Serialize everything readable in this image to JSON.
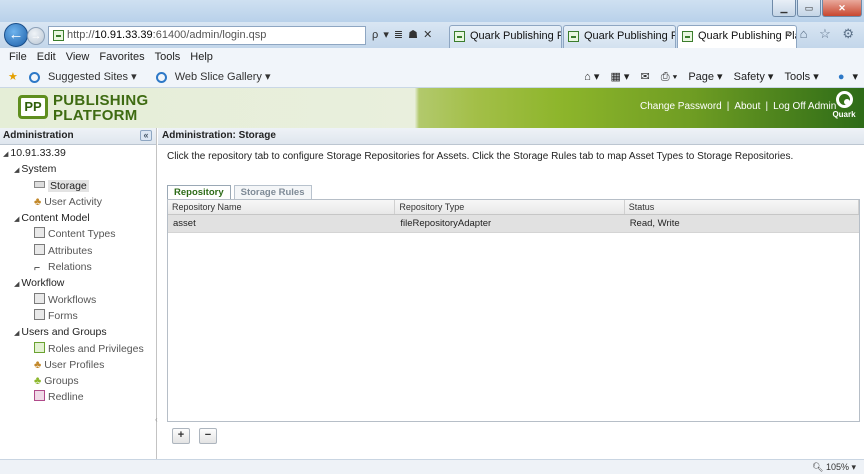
{
  "browser": {
    "address_prefix": "http://",
    "address_host": "10.91.33.39",
    "address_rest": ":61400/admin/login.qsp",
    "address_tools": "ρ ▾ ≣ ☗ ✕",
    "tabs": [
      {
        "label": "Quark Publishing Platform"
      },
      {
        "label": "Quark Publishing Platfor..."
      },
      {
        "label": "Quark Publishing Platf...",
        "close": "×"
      }
    ],
    "right_icons": "⌂ ☆ ⚙",
    "menu": [
      "File",
      "Edit",
      "View",
      "Favorites",
      "Tools",
      "Help"
    ],
    "favorites": {
      "suggested": "Suggested Sites ▾",
      "webslice": "Web Slice Gallery ▾"
    },
    "command_bar": {
      "page": "Page ▾",
      "safety": "Safety ▾",
      "tools": "Tools ▾",
      "help": "▾"
    },
    "zoom": "105%"
  },
  "header": {
    "logo_mark": "PP",
    "logo_line1": "PUBLISHING",
    "logo_line2": "PLATFORM",
    "links": {
      "change_password": "Change Password",
      "about": "About",
      "log_off": "Log Off Admin"
    },
    "quark_label": "Quark"
  },
  "sidebar": {
    "title": "Administration",
    "collapse": "«",
    "tree": [
      {
        "label": "10.91.33.39",
        "level": 0
      },
      {
        "label": "System",
        "level": 1
      },
      {
        "label": "Storage",
        "level": 2
      },
      {
        "label": "User Activity",
        "level": 2
      },
      {
        "label": "Content Model",
        "level": 0
      },
      {
        "label": "Content Types",
        "level": 2
      },
      {
        "label": "Attributes",
        "level": 2
      },
      {
        "label": "Relations",
        "level": 2
      },
      {
        "label": "Workflow",
        "level": 0
      },
      {
        "label": "Workflows",
        "level": 2
      },
      {
        "label": "Forms",
        "level": 2
      },
      {
        "label": "Users and Groups",
        "level": 0
      },
      {
        "label": "Roles and Privileges",
        "level": 2
      },
      {
        "label": "User Profiles",
        "level": 2
      },
      {
        "label": "Groups",
        "level": 2
      },
      {
        "label": "Redline",
        "level": 2
      }
    ]
  },
  "main": {
    "title": "Administration: Storage",
    "instructions": "Click the repository tab to configure Storage Repositories for Assets. Click the Storage Rules tab to map Asset Types to Storage Repositories.",
    "tabs": [
      "Repository",
      "Storage Rules"
    ],
    "columns": [
      "Repository Name",
      "Repository Type",
      "Status"
    ],
    "rows": [
      {
        "name": "asset",
        "type": "fileRepositoryAdapter",
        "status": "Read, Write"
      }
    ],
    "add_label": "+",
    "remove_label": "−"
  }
}
